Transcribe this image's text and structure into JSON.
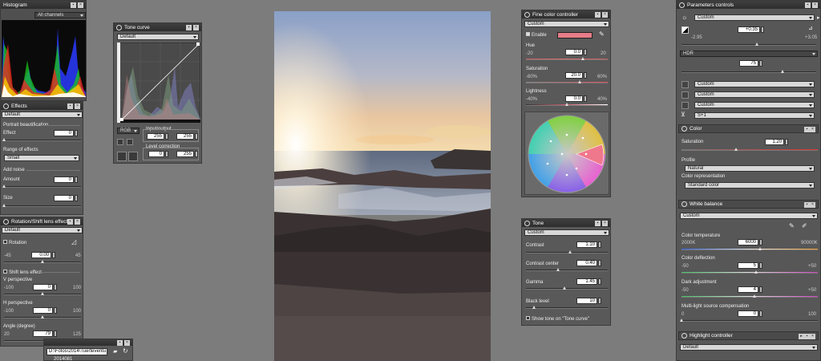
{
  "histogram": {
    "title": "Histogram",
    "channel": "All channels"
  },
  "effects": {
    "title": "Effects",
    "preset": "Default",
    "portrait_section": "Portrait beautification",
    "effect_label": "Effect",
    "effect_value": "0",
    "range_label": "Range of effects",
    "range_value": "Small",
    "noise_section": "Add noise",
    "amount_label": "Amount",
    "amount_value": "0",
    "size_label": "Size",
    "size_value": "0"
  },
  "rotation": {
    "title": "Rotation/Shift lens effect",
    "preset": "Default",
    "rotation_label": "Rotation",
    "rot_min": "-45",
    "rot_value": "0.00",
    "rot_max": "45",
    "shift_label": "Shift lens effect",
    "v_label": "V perspective",
    "v_min": "-100",
    "v_value": "0",
    "v_max": "100",
    "h_label": "H perspective",
    "h_min": "-100",
    "h_value": "0",
    "h_max": "100",
    "angle_label": "Angle (degree)",
    "angle_min": "20",
    "angle_value": "79",
    "angle_max": "125"
  },
  "folder": {
    "path": "D:\\Fotos\\2014\\Tuerteventu",
    "item": "2014081"
  },
  "tone_curve": {
    "title": "Tone curve",
    "preset": "Default",
    "channel": "RGB",
    "io_label": "Input/output",
    "in_value": "255",
    "out_value": "255",
    "level_label": "Level correction",
    "level_min": "0",
    "level_max": "255"
  },
  "fine_color": {
    "title": "Fine color controller",
    "preset": "Custom",
    "enable_label": "Enable",
    "swatch_color": "#e77c88",
    "hue_label": "Hue",
    "hue_min": "-20",
    "hue_value": "0.0",
    "hue_max": "20",
    "sat_label": "Saturation",
    "sat_min": "-60%",
    "sat_value": "20.0",
    "sat_max": "60%",
    "light_label": "Lightness",
    "light_min": "-40%",
    "light_value": "0.0",
    "light_max": "40%"
  },
  "tone": {
    "title": "Tone",
    "preset": "Custom",
    "contrast_label": "Contrast",
    "contrast_value": "1.10",
    "center_label": "Contrast center",
    "center_value": "0.40",
    "gamma_label": "Gamma",
    "gamma_value": "1.45",
    "black_label": "Black level",
    "black_value": "10",
    "show_label": "Show tone on \"Tone curve\""
  },
  "params": {
    "title": "Parameters controls",
    "preset": "Custom",
    "exposure_min": "-2.95",
    "exposure_value": "+0.35",
    "exposure_max": "+3.05",
    "hdr_label": "HDR",
    "hdr_value": "75",
    "row1": "Custom",
    "row2": "Custom",
    "row3": "Custom",
    "row4": "S+1"
  },
  "color": {
    "title": "Color",
    "saturation_label": "Saturation",
    "saturation_value": "1.20",
    "profile_label": "Profile",
    "profile_value": "Natural",
    "rep_label": "Color representation",
    "rep_value": "Standard color"
  },
  "white_balance": {
    "title": "White balance",
    "preset": "Custom",
    "temp_label": "Color temperature",
    "temp_min": "2000K",
    "temp_value": "6000",
    "temp_max": "90000K",
    "defl_label": "Color deflection",
    "defl_min": "-50",
    "defl_value": "5",
    "defl_max": "+50",
    "dark_label": "Dark adjustment",
    "dark_min": "-50",
    "dark_value": "4",
    "dark_max": "+50",
    "multi_label": "Multi-light source compensation",
    "multi_min": "0",
    "multi_value": "0",
    "multi_max": "100"
  },
  "highlight": {
    "title": "Highlight controller",
    "preset": "Default"
  }
}
